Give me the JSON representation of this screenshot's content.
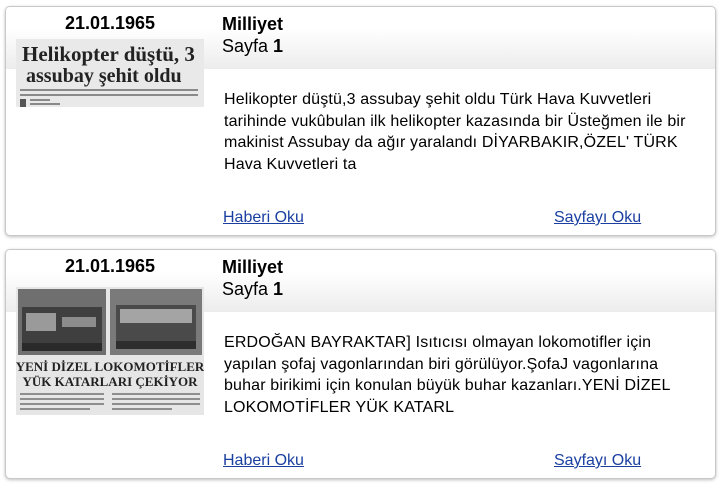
{
  "results": [
    {
      "date": "21.01.1965",
      "source": "Milliyet",
      "page_label": "Sayfa",
      "page_number": "1",
      "thumbnail_headline": "Helikopter düştü, 3 assubay şehit oldu",
      "excerpt": "Helikopter düştü,3 assubay şehit oldu Türk Hava Kuvvetleri tarihinde vukûbulan ilk helikopter kazasında bir Üsteğmen ile bir makinist Assubay da ağır yaralandı DİYARBAKIR,ÖZEL' TÜRK Hava Kuvvetleri ta",
      "read_link": "Haberi Oku",
      "page_link": "Sayfayı Oku"
    },
    {
      "date": "21.01.1965",
      "source": "Milliyet",
      "page_label": "Sayfa",
      "page_number": "1",
      "thumbnail_headline": "YENİ DİZEL LOKOMOTİFLER YÜK KATARLARI ÇEKİYOR",
      "excerpt": "ERDOĞAN BAYRAKTAR] Isıtıcısı olmayan lokomotifler için yapılan şofaj vagonlarından biri görülüyor.ŞofaJ vagonlarına buhar birikimi için konulan büyük buhar kazanları.YENİ DİZEL LOKOMOTİFLER YÜK KATARL",
      "read_link": "Haberi Oku",
      "page_link": "Sayfayı Oku"
    }
  ],
  "colors": {
    "link": "#1a3fa0",
    "card_border": "#c8c8c8",
    "header_gradient_end": "#ececec"
  }
}
